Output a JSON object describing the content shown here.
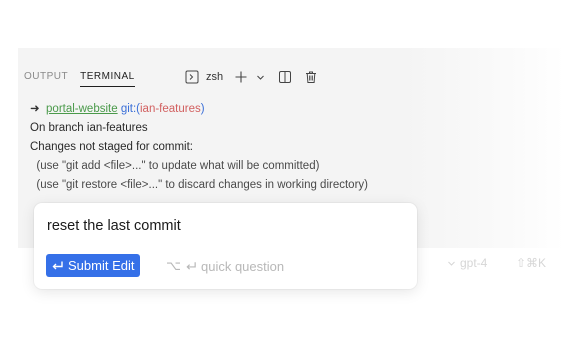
{
  "panel": {
    "tabs": [
      {
        "label": "OUTPUT",
        "active": false
      },
      {
        "label": "TERMINAL",
        "active": true
      }
    ],
    "shell": "zsh"
  },
  "terminal": {
    "prompt_arrow": "➜",
    "repo": "portal-website",
    "git_prefix": "git:(",
    "branch": "ian-features",
    "git_suffix": ")",
    "lines": [
      "On branch ian-features",
      "Changes not staged for commit:",
      "  (use \"git add <file>...\" to update what will be committed)",
      "  (use \"git restore <file>...\" to discard changes in working directory)"
    ]
  },
  "background_ghost": {
    "model": "gpt-4",
    "shortcut": "⇧⌘K"
  },
  "edit_popup": {
    "input_value": "reset the last commit",
    "submit_label": "Submit Edit",
    "quick_shortcut": "⌥",
    "quick_label": "quick question"
  },
  "colors": {
    "accent": "#3570e8",
    "repo_green": "#4a9a4a",
    "git_blue": "#3a6fd8",
    "branch_red": "#d26060"
  }
}
